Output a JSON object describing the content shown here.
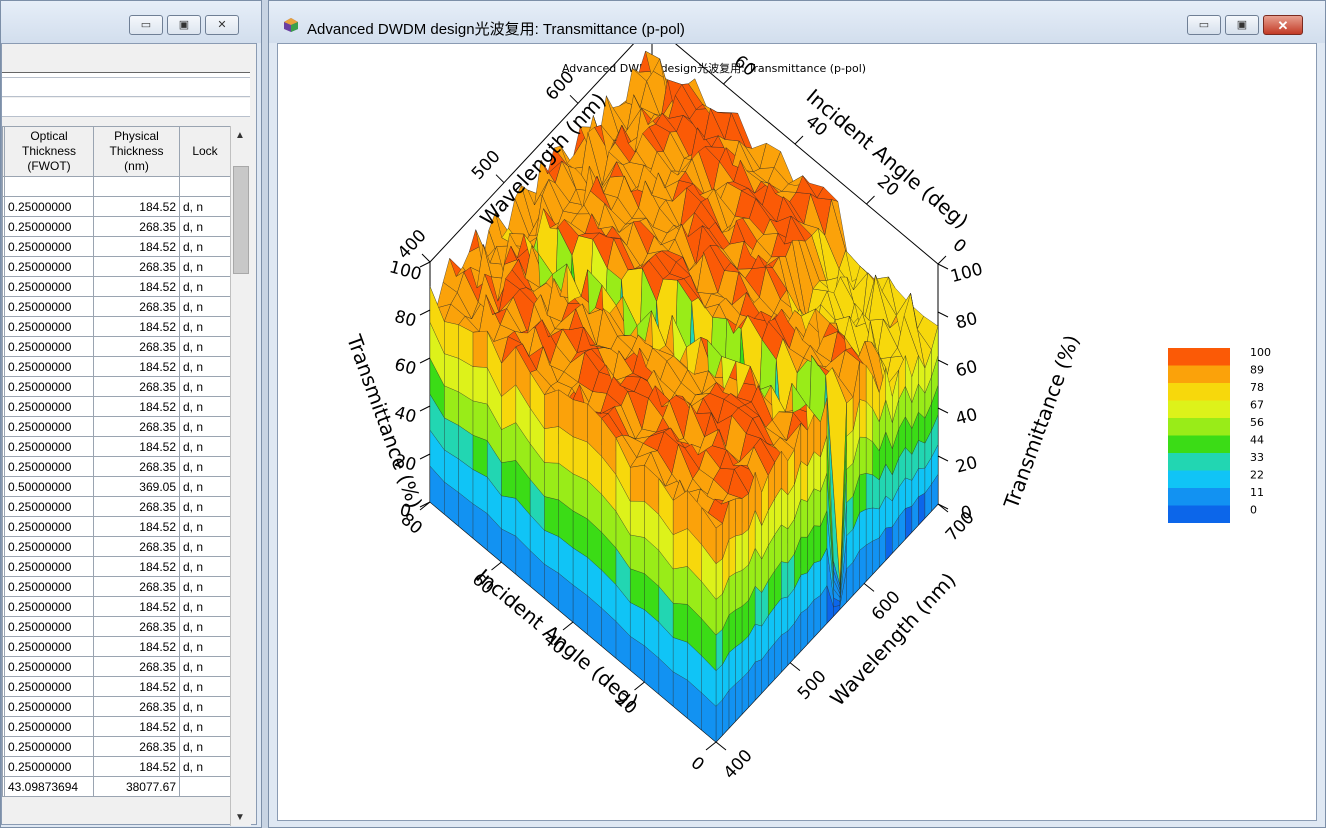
{
  "left_window": {
    "table": {
      "headers": [
        {
          "lines": [
            "Optical",
            "Thickness",
            "(FWOT)"
          ]
        },
        {
          "lines": [
            "Physical",
            "Thickness",
            "(nm)"
          ]
        },
        {
          "lines": [
            "Lock"
          ]
        }
      ],
      "rows": [
        {
          "optical": "0.25000000",
          "physical": "184.52",
          "lock": "d, n"
        },
        {
          "optical": "0.25000000",
          "physical": "268.35",
          "lock": "d, n"
        },
        {
          "optical": "0.25000000",
          "physical": "184.52",
          "lock": "d, n"
        },
        {
          "optical": "0.25000000",
          "physical": "268.35",
          "lock": "d, n"
        },
        {
          "optical": "0.25000000",
          "physical": "184.52",
          "lock": "d, n"
        },
        {
          "optical": "0.25000000",
          "physical": "268.35",
          "lock": "d, n"
        },
        {
          "optical": "0.25000000",
          "physical": "184.52",
          "lock": "d, n"
        },
        {
          "optical": "0.25000000",
          "physical": "268.35",
          "lock": "d, n"
        },
        {
          "optical": "0.25000000",
          "physical": "184.52",
          "lock": "d, n"
        },
        {
          "optical": "0.25000000",
          "physical": "268.35",
          "lock": "d, n"
        },
        {
          "optical": "0.25000000",
          "physical": "184.52",
          "lock": "d, n"
        },
        {
          "optical": "0.25000000",
          "physical": "268.35",
          "lock": "d, n"
        },
        {
          "optical": "0.25000000",
          "physical": "184.52",
          "lock": "d, n"
        },
        {
          "optical": "0.25000000",
          "physical": "268.35",
          "lock": "d, n"
        },
        {
          "optical": "0.50000000",
          "physical": "369.05",
          "lock": "d, n"
        },
        {
          "optical": "0.25000000",
          "physical": "268.35",
          "lock": "d, n"
        },
        {
          "optical": "0.25000000",
          "physical": "184.52",
          "lock": "d, n"
        },
        {
          "optical": "0.25000000",
          "physical": "268.35",
          "lock": "d, n"
        },
        {
          "optical": "0.25000000",
          "physical": "184.52",
          "lock": "d, n"
        },
        {
          "optical": "0.25000000",
          "physical": "268.35",
          "lock": "d, n"
        },
        {
          "optical": "0.25000000",
          "physical": "184.52",
          "lock": "d, n"
        },
        {
          "optical": "0.25000000",
          "physical": "268.35",
          "lock": "d, n"
        },
        {
          "optical": "0.25000000",
          "physical": "184.52",
          "lock": "d, n"
        },
        {
          "optical": "0.25000000",
          "physical": "268.35",
          "lock": "d, n"
        },
        {
          "optical": "0.25000000",
          "physical": "184.52",
          "lock": "d, n"
        },
        {
          "optical": "0.25000000",
          "physical": "268.35",
          "lock": "d, n"
        },
        {
          "optical": "0.25000000",
          "physical": "184.52",
          "lock": "d, n"
        },
        {
          "optical": "0.25000000",
          "physical": "268.35",
          "lock": "d, n"
        },
        {
          "optical": "0.25000000",
          "physical": "184.52",
          "lock": "d, n"
        }
      ],
      "totals": {
        "optical": "43.09873694",
        "physical": "38077.67",
        "lock": ""
      }
    }
  },
  "right_window": {
    "title": "Advanced DWDM design光波复用: Transmittance (p-pol)",
    "chart_title": "Advanced DWDM design光波复用: Transmittance (p-pol)"
  },
  "chart_data": {
    "type": "surface3d",
    "title": "Advanced DWDM design光波复用: Transmittance (p-pol)",
    "axes": {
      "wavelength": {
        "label": "Wavelength (nm)",
        "range": [
          400,
          700
        ],
        "ticks": [
          400,
          500,
          600,
          700
        ]
      },
      "angle": {
        "label": "Incident Angle (deg)",
        "range": [
          0,
          80
        ],
        "ticks": [
          0,
          20,
          40,
          60,
          80
        ]
      },
      "transmittance": {
        "label": "Transmittance (%)",
        "range": [
          0,
          100
        ],
        "ticks": [
          0,
          20,
          40,
          60,
          80,
          100
        ]
      }
    },
    "colorbar": {
      "levels": [
        100,
        89,
        78,
        67,
        56,
        44,
        33,
        22,
        11,
        0
      ],
      "colors": [
        "#fb5a06",
        "#fba20a",
        "#f7d80c",
        "#ddf21a",
        "#99ec18",
        "#3bdc16",
        "#22d6b2",
        "#10c4f6",
        "#1292f2",
        "#0c66ea"
      ]
    },
    "surface_summary": {
      "plateau_transmittance": 100,
      "notch_minimum_transmittance": 0
    }
  }
}
